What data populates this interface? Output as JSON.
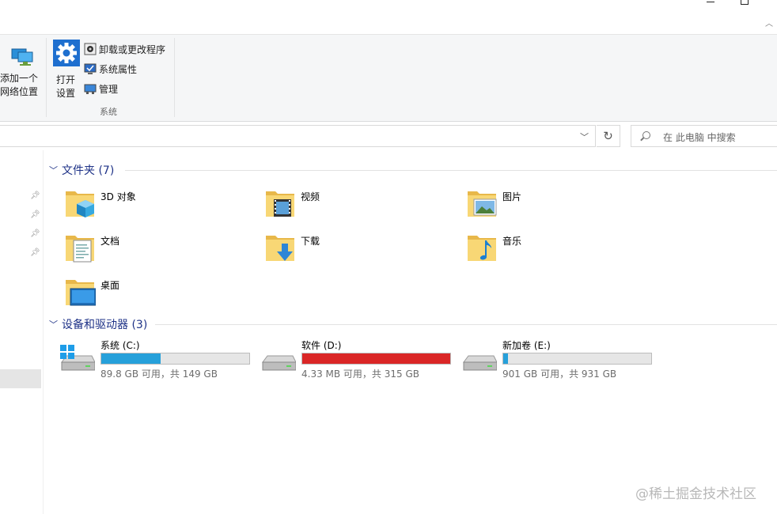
{
  "ribbon": {
    "add_network_location": [
      "添加一个",
      "网络位置"
    ],
    "open_settings": [
      "打开",
      "设置"
    ],
    "uninstall": "卸载或更改程序",
    "system_properties": "系统属性",
    "manage": "管理",
    "group_system": "系统"
  },
  "search": {
    "placeholder": "在 此电脑 中搜索"
  },
  "folders": {
    "header": "文件夹 (7)",
    "items": [
      {
        "label": "3D 对象",
        "icon": "3d-objects"
      },
      {
        "label": "视频",
        "icon": "videos"
      },
      {
        "label": "图片",
        "icon": "pictures"
      },
      {
        "label": "文档",
        "icon": "documents"
      },
      {
        "label": "下载",
        "icon": "downloads"
      },
      {
        "label": "音乐",
        "icon": "music"
      },
      {
        "label": "桌面",
        "icon": "desktop"
      }
    ]
  },
  "devices": {
    "header": "设备和驱动器 (3)",
    "drives": [
      {
        "name": "系统 (C:)",
        "free_text": "89.8 GB 可用，共 149 GB",
        "used_fraction": 0.4,
        "bar_color": "#26a0da"
      },
      {
        "name": "软件 (D:)",
        "free_text": "4.33 MB 可用，共 315 GB",
        "used_fraction": 1.0,
        "bar_color": "#da2626"
      },
      {
        "name": "新加卷 (E:)",
        "free_text": "901 GB 可用，共 931 GB",
        "used_fraction": 0.03,
        "bar_color": "#26a0da"
      }
    ]
  },
  "watermark": "@稀土掘金技术社区"
}
